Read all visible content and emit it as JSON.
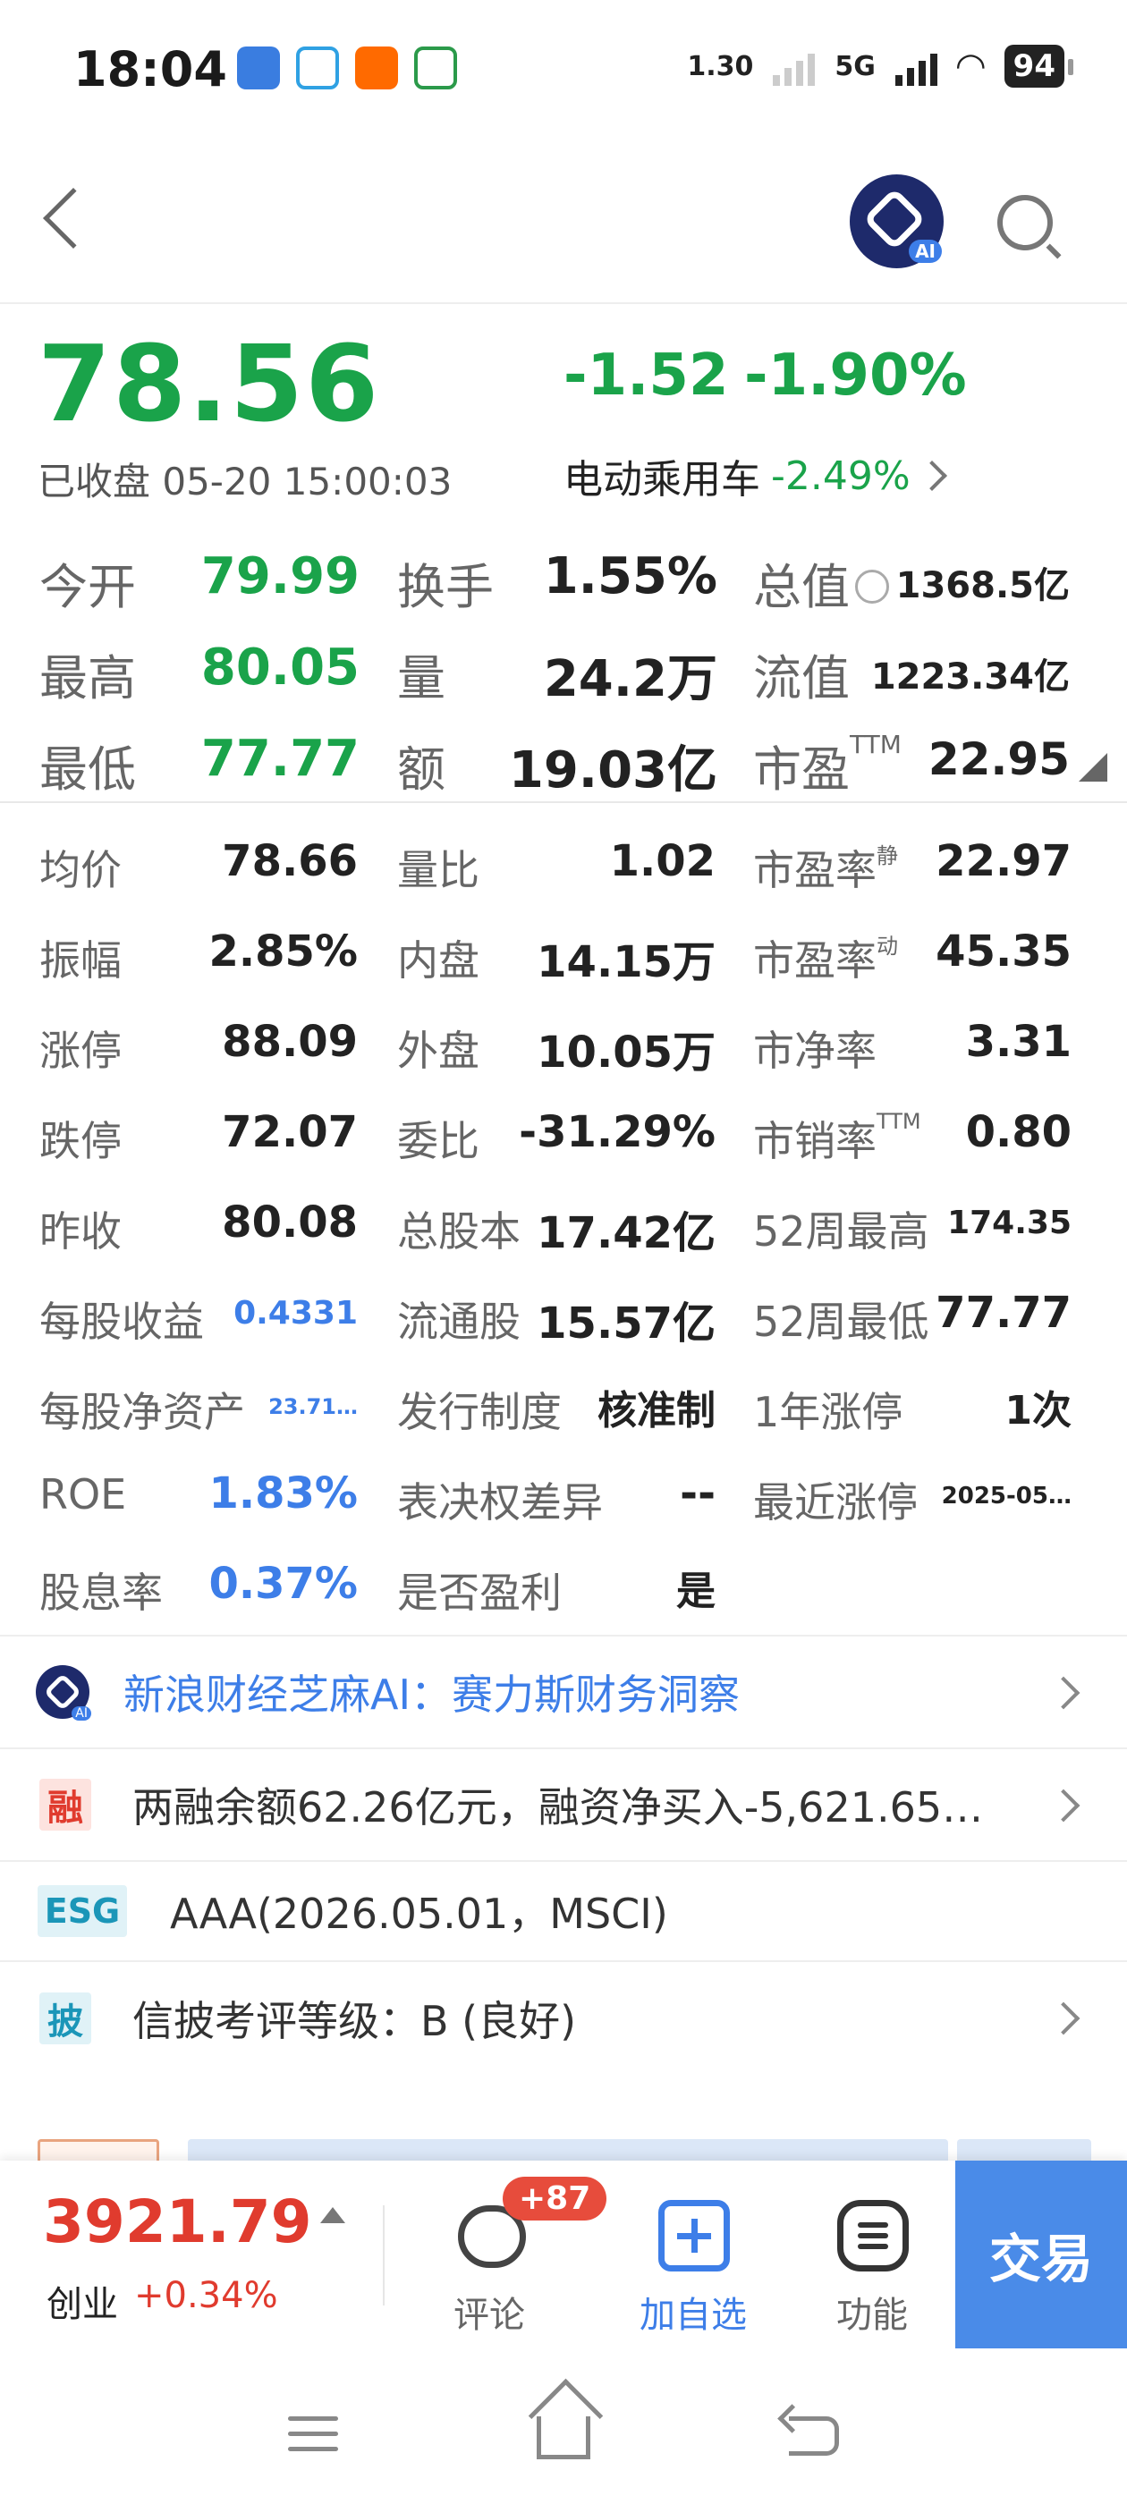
{
  "status_bar": {
    "time": "18:04",
    "net_speed": "1.30",
    "network": "5G",
    "battery": "94"
  },
  "quote": {
    "price": "78.56",
    "change": "-1.52",
    "change_pct": "-1.90%",
    "status_time": "已收盘 05-20 15:00:03",
    "sector_name": "电动乘用车",
    "sector_change": "-2.49%"
  },
  "top_stats": [
    [
      {
        "label": "今开",
        "value": "79.99"
      },
      {
        "label": "换手",
        "value": "1.55%"
      },
      {
        "label": "总值",
        "value": "1368.5亿"
      }
    ],
    [
      {
        "label": "最高",
        "value": "80.05"
      },
      {
        "label": "量",
        "value": "24.2万"
      },
      {
        "label": "流值",
        "value": "1223.34亿"
      }
    ],
    [
      {
        "label": "最低",
        "value": "77.77"
      },
      {
        "label": "额",
        "value": "19.03亿"
      },
      {
        "label": "市盈",
        "sup": "TTM",
        "value": "22.95"
      }
    ]
  ],
  "detail": {
    "r1": {
      "l1": "均价",
      "v1": "78.66",
      "l2": "量比",
      "v2": "1.02",
      "l3": "市盈率",
      "s3": "静",
      "v3": "22.97"
    },
    "r2": {
      "l1": "振幅",
      "v1": "2.85%",
      "l2": "内盘",
      "v2": "14.15万",
      "l3": "市盈率",
      "s3": "动",
      "v3": "45.35"
    },
    "r3": {
      "l1": "涨停",
      "v1": "88.09",
      "l2": "外盘",
      "v2": "10.05万",
      "l3": "市净率",
      "v3": "3.31"
    },
    "r4": {
      "l1": "跌停",
      "v1": "72.07",
      "l2": "委比",
      "v2": "-31.29%",
      "l3": "市销率",
      "s3": "TTM",
      "v3": "0.80"
    },
    "r5": {
      "l1": "昨收",
      "v1": "80.08",
      "l2": "总股本",
      "v2": "17.42亿",
      "l3": "52周最高",
      "v3": "174.35"
    },
    "r6": {
      "l1": "每股收益",
      "v1": "0.4331",
      "l2": "流通股",
      "v2": "15.57亿",
      "l3": "52周最低",
      "v3": "77.77"
    },
    "r7": {
      "l1": "每股净资产",
      "v1": "23.71…",
      "l2": "发行制度",
      "v2": "核准制",
      "l3": "1年涨停",
      "v3": "1次"
    },
    "r8": {
      "l1": "ROE",
      "v1": "1.83%",
      "l2": "表决权差异",
      "v2": "--",
      "l3": "最近涨停",
      "v3": "2025-05…"
    },
    "r9": {
      "l1": "股息率",
      "v1": "0.37%",
      "l2": "是否盈利",
      "v2": "是"
    }
  },
  "info_list": {
    "ai_text": "新浪财经芝麻AI：赛力斯财务洞察",
    "margin_badge": "融",
    "margin_text": "两融余额62.26亿元，融资净买入-5,621.65…",
    "esg_badge": "ESG",
    "esg_text": "AAA(2026.05.01，MSCI)",
    "disclosure_badge": "披",
    "disclosure_text": "信披考评等级：B (良好)"
  },
  "bottom_bar": {
    "index_value": "3921.79",
    "index_name": "创业",
    "index_change": "+0.34%",
    "comment_label": "评论",
    "comment_badge": "+87",
    "watch_label": "加自选",
    "function_label": "功能",
    "trade_label": "交易"
  },
  "colors": {
    "down_green": "#1aa34a",
    "up_red": "#e03b2e",
    "accent_blue": "#3d7ee8",
    "trade_button": "#4a8be8"
  },
  "icons": [
    "back-icon",
    "ai-logo-icon",
    "search-icon",
    "info-icon",
    "chevron-right-icon",
    "comment-icon",
    "add-watchlist-icon",
    "menu-icon"
  ]
}
